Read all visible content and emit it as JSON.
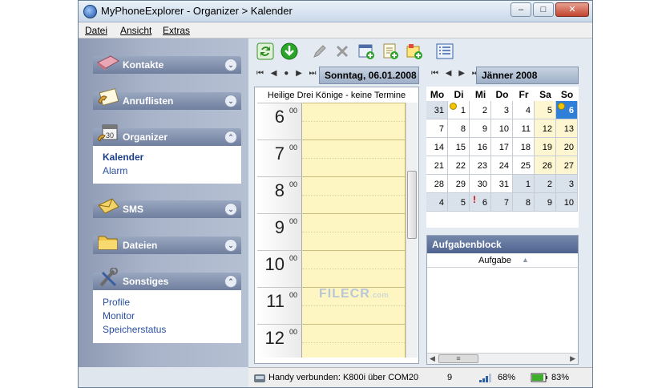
{
  "window": {
    "title": "MyPhoneExplorer - Organizer > Kalender"
  },
  "menu": {
    "items": [
      "Datei",
      "Ansicht",
      "Extras"
    ]
  },
  "sidebar": {
    "groups": [
      {
        "title": "Kontakte",
        "links": []
      },
      {
        "title": "Anruflisten",
        "links": []
      },
      {
        "title": "Organizer",
        "links": [
          "Kalender",
          "Alarm"
        ]
      },
      {
        "title": "SMS",
        "links": []
      },
      {
        "title": "Dateien",
        "links": []
      },
      {
        "title": "Sonstiges",
        "links": [
          "Profile",
          "Monitor",
          "Speicherstatus"
        ]
      }
    ]
  },
  "day_view": {
    "date": "Sonntag, 06.01.2008",
    "header": "Heilige Drei Könige - keine Termine",
    "hours": [
      "6",
      "7",
      "8",
      "9",
      "10",
      "11",
      "12"
    ],
    "minutes_label": "00"
  },
  "calendar": {
    "month": "Jänner 2008",
    "weekdays": [
      "Mo",
      "Di",
      "Mi",
      "Do",
      "Fr",
      "Sa",
      "So"
    ],
    "rows": [
      [
        "31",
        "1",
        "2",
        "3",
        "4",
        "5",
        "6"
      ],
      [
        "7",
        "8",
        "9",
        "10",
        "11",
        "12",
        "13"
      ],
      [
        "14",
        "15",
        "16",
        "17",
        "18",
        "19",
        "20"
      ],
      [
        "21",
        "22",
        "23",
        "24",
        "25",
        "26",
        "27"
      ],
      [
        "28",
        "29",
        "30",
        "31",
        "1",
        "2",
        "3"
      ],
      [
        "4",
        "5",
        "6",
        "7",
        "8",
        "9",
        "10"
      ]
    ]
  },
  "tasks": {
    "title": "Aufgabenblock",
    "column": "Aufgabe"
  },
  "watermark": {
    "text": "FILECR",
    "suffix": ".com"
  },
  "status": {
    "connection": "Handy verbunden: K800i über COM20",
    "signal_value": "9",
    "signal_percent": "68%",
    "battery_percent": "83%"
  },
  "colors": {
    "accent": "#2f7fd8",
    "day_slots": "#fdf6c2",
    "sidebar_header": "#6f7f9e"
  }
}
